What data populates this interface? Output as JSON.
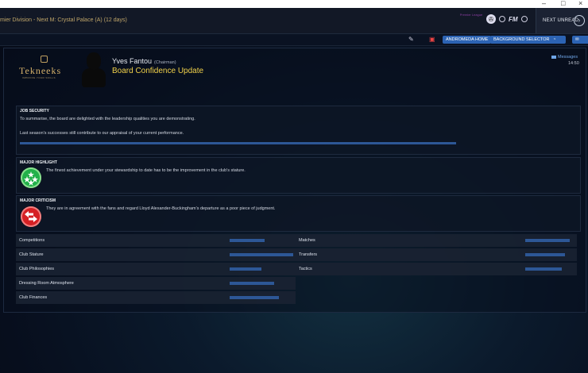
{
  "window": {
    "minimize": "–",
    "maximize": "□",
    "close": "×"
  },
  "topbar": {
    "next_match": "mier Division - Next M: Crystal Palace (A) (12 days)",
    "league_logo_text": "Premier League",
    "fm_label": "FM",
    "next_unread": "NEXT UNREAD"
  },
  "toolbar": {
    "andromeda_home": "ANDROMEDA HOME",
    "background_selector": "BACKGROUND SELECTOR"
  },
  "club": {
    "name": "Tekneeks",
    "tagline": "IMPROVE YOUR SKILLS"
  },
  "message": {
    "sender_name": "Yves Fantou",
    "sender_role": "(Chairman)",
    "title": "Board Confidence Update",
    "messages_link": "Messages",
    "time": "14:50"
  },
  "job_security": {
    "heading": "JOB SECURITY",
    "line1": "To summarise, the board are delighted with the leadership qualities you are demonstrating.",
    "line2": "Last season's successes still contribute to our appraisal of your current performance.",
    "confidence": 0.9
  },
  "major_highlight": {
    "heading": "MAJOR HIGHLIGHT",
    "text": "The finest achievement under your stewardship to date has to be the improvement in the club's stature."
  },
  "major_criticism": {
    "heading": "MAJOR CRITICISM",
    "text": "They are in agreement with the fans and regard Lloyd Alexander-Buckingham's departure as a poor piece of judgment."
  },
  "stats_left": [
    {
      "label": "Competitions",
      "value": 0.55
    },
    {
      "label": "Club Stature",
      "value": 1.0
    },
    {
      "label": "Club Philosophies",
      "value": 0.5
    },
    {
      "label": "Dressing Room Atmosphere",
      "value": 0.7
    },
    {
      "label": "Club Finances",
      "value": 0.78
    }
  ],
  "stats_right": [
    {
      "label": "Matches",
      "value": 0.7
    },
    {
      "label": "Transfers",
      "value": 0.62
    },
    {
      "label": "Tactics",
      "value": 0.58
    }
  ],
  "colors": {
    "accent": "#2c63b3",
    "title": "#f1d14a",
    "bar": "#2d5796",
    "highlight": "#22b04a",
    "criticism": "#d52024"
  }
}
